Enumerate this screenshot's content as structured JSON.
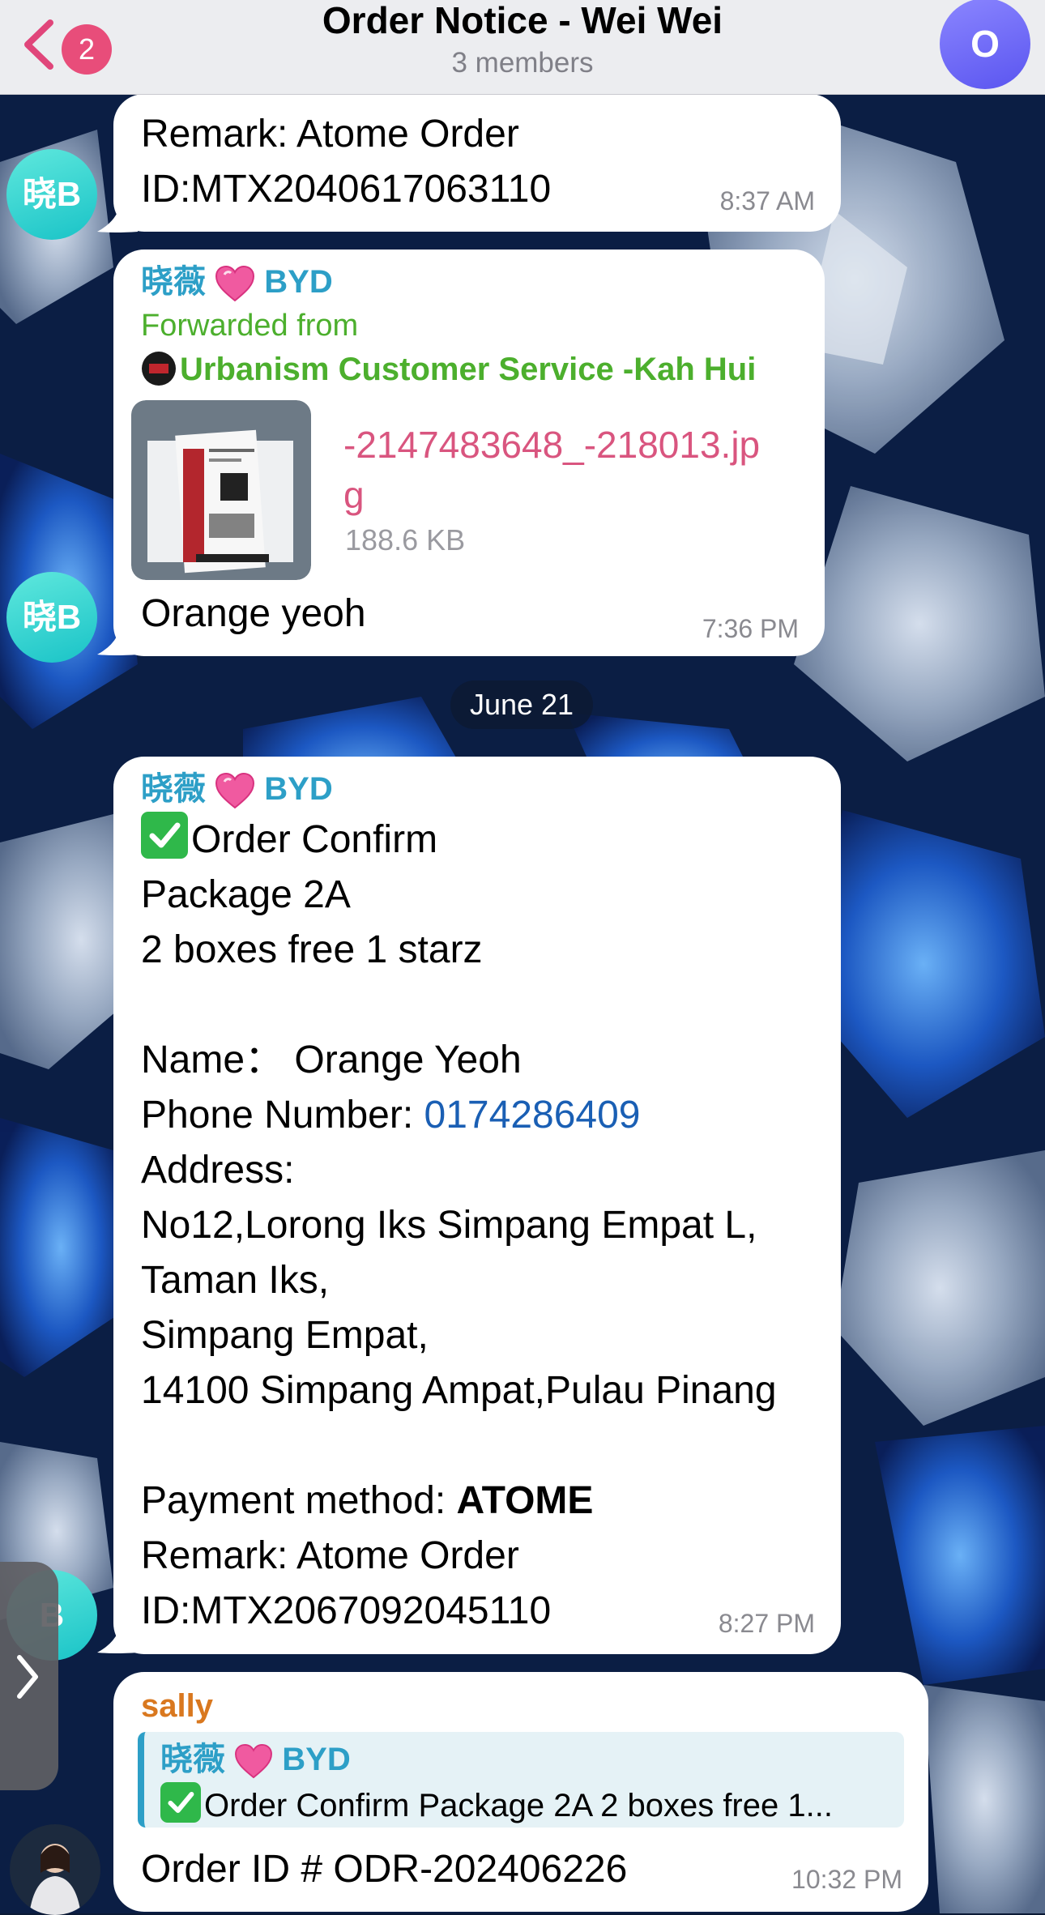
{
  "header": {
    "back_badge": "2",
    "title": "Order Notice - Wei Wei",
    "subtitle": "3 members",
    "avatar_letter": "O"
  },
  "messages": {
    "m1": {
      "avatar": "晓B",
      "lines": [
        "Remark: Atome Order",
        "ID:MTX2040617063110"
      ],
      "time": "8:37 AM"
    },
    "m2": {
      "avatar": "晓B",
      "sender_pre": "晓薇",
      "sender_post": "BYD",
      "forwarded_label": "Forwarded from",
      "forwarded_source": "Urbanism Customer Service -Kah Hui",
      "file_name_1": "-2147483648_-218013.jp",
      "file_name_2": "g",
      "file_size": "188.6 KB",
      "text": "Orange yeoh",
      "time": "7:36 PM"
    },
    "date_separator": "June 21",
    "m3": {
      "avatar": "B",
      "sender_pre": "晓薇",
      "sender_post": "BYD",
      "confirm": "Order Confirm",
      "package": "Package 2A",
      "promo": "2 boxes free 1 starz",
      "name": "Name：  Orange Yeoh",
      "phone_label": "Phone Number: ",
      "phone": "0174286409",
      "address_label": "Address:",
      "address_1": "No12,Lorong Iks Simpang Empat L,",
      "address_2": "Taman Iks,",
      "address_3": "Simpang Empat,",
      "address_4": "14100 Simpang Ampat,Pulau Pinang",
      "payment_label": "Payment method: ",
      "payment_value": "ATOME",
      "remark": "Remark: Atome Order",
      "order_id": "ID:MTX2067092045110",
      "time": "8:27 PM"
    },
    "m4": {
      "sender": "sally",
      "reply_sender_pre": "晓薇",
      "reply_sender_post": "BYD",
      "reply_text": "Order Confirm Package 2A 2 boxes free 1...",
      "text": "Order ID # ODR-202406226",
      "time": "10:32 PM"
    }
  },
  "colors": {
    "header_bg": "#f4f4f6",
    "avatar_teal": "#19c3c7",
    "sender_blue": "#2d9fc7",
    "forward_green": "#4caf2d",
    "file_pink": "#d9557f",
    "sally_orange": "#d9781f",
    "check_green": "#2fb84a",
    "link_blue": "#1a5fb4"
  },
  "icons": {
    "back": "chevron-left-icon",
    "heart": "pink-heart-emoji",
    "check": "check-mark-button-emoji",
    "side": "chevron-right-icon"
  }
}
